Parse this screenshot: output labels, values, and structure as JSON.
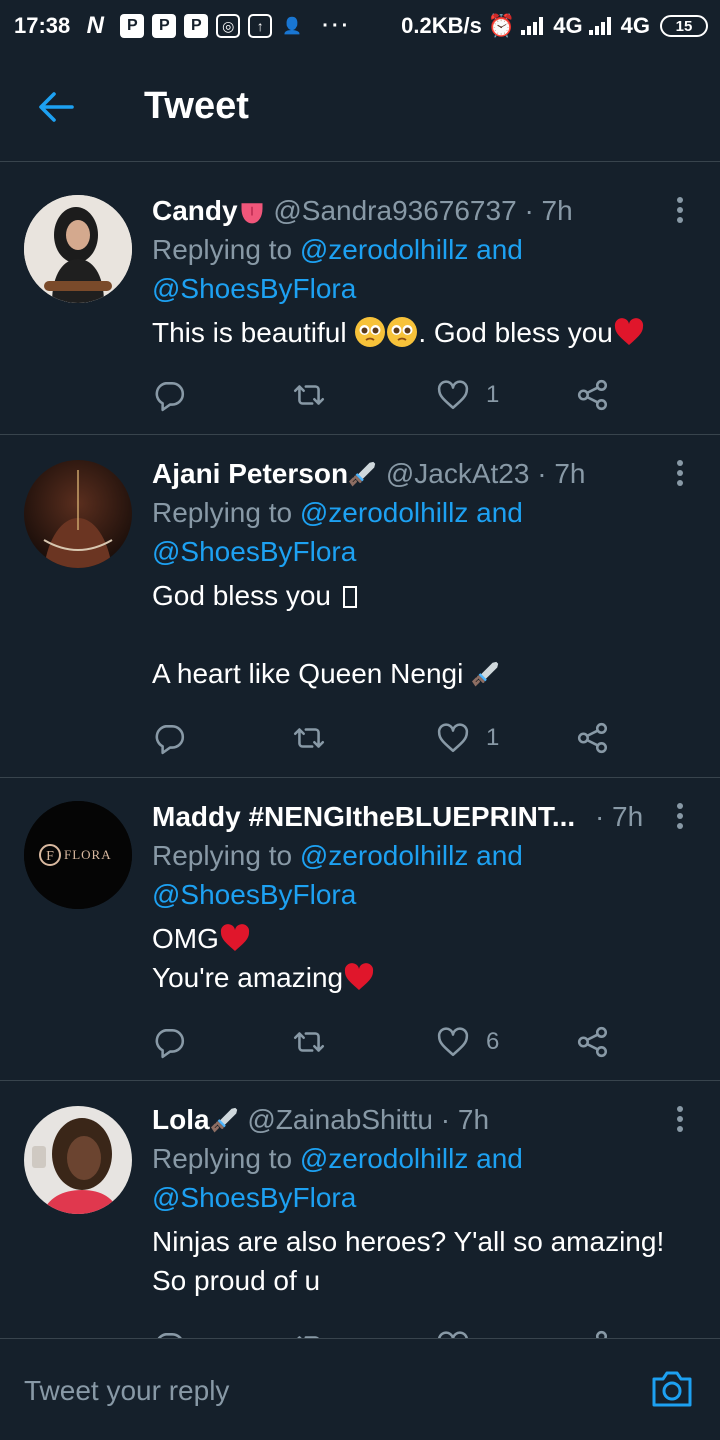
{
  "status_bar": {
    "time": "17:38",
    "speed": "0.2KB/s",
    "net1": "4G",
    "net2": "4G",
    "battery": "15"
  },
  "header": {
    "title": "Tweet"
  },
  "colors": {
    "background": "#15202b",
    "link": "#1da1f2",
    "muted": "#8899a6",
    "divider": "#38444d"
  },
  "tweets": [
    {
      "name": "Candy",
      "handle": "@Sandra93676737",
      "time": "· 7h",
      "replying_prefix": "Replying to",
      "replying_user1": "@zerodolhillz",
      "replying_and": "and",
      "replying_user2": "@ShoesByFlora",
      "text_main": "This is beautiful",
      "text_end": ". God bless you",
      "like_count": "1"
    },
    {
      "name": "Ajani Peterson",
      "handle": "@JackAt23",
      "time": "· 7h",
      "replying_prefix": "Replying to",
      "replying_user1": "@zerodolhillz",
      "replying_and": "and",
      "replying_user2": "@ShoesByFlora",
      "text_line1": "God bless you",
      "text_line2": "A heart like Queen Nengi",
      "like_count": "1"
    },
    {
      "name": "Maddy #NENGItheBLUEPRINT...",
      "time": "· 7h",
      "avatar_text": "FLORA",
      "replying_prefix": "Replying to",
      "replying_user1": "@zerodolhillz",
      "replying_and": "and",
      "replying_user2": "@ShoesByFlora",
      "text_line1": "OMG",
      "text_line2": "You're amazing",
      "like_count": "6"
    },
    {
      "name": "Lola",
      "handle": "@ZainabShittu",
      "time": "· 7h",
      "replying_prefix": "Replying to",
      "replying_user1": "@zerodolhillz",
      "replying_and": "and",
      "replying_user2": "@ShoesByFlora",
      "text_line1": "Ninjas are also heroes? Y'all so amazing!",
      "text_line2": "So proud of u"
    }
  ],
  "reply_bar": {
    "placeholder": "Tweet your reply"
  }
}
